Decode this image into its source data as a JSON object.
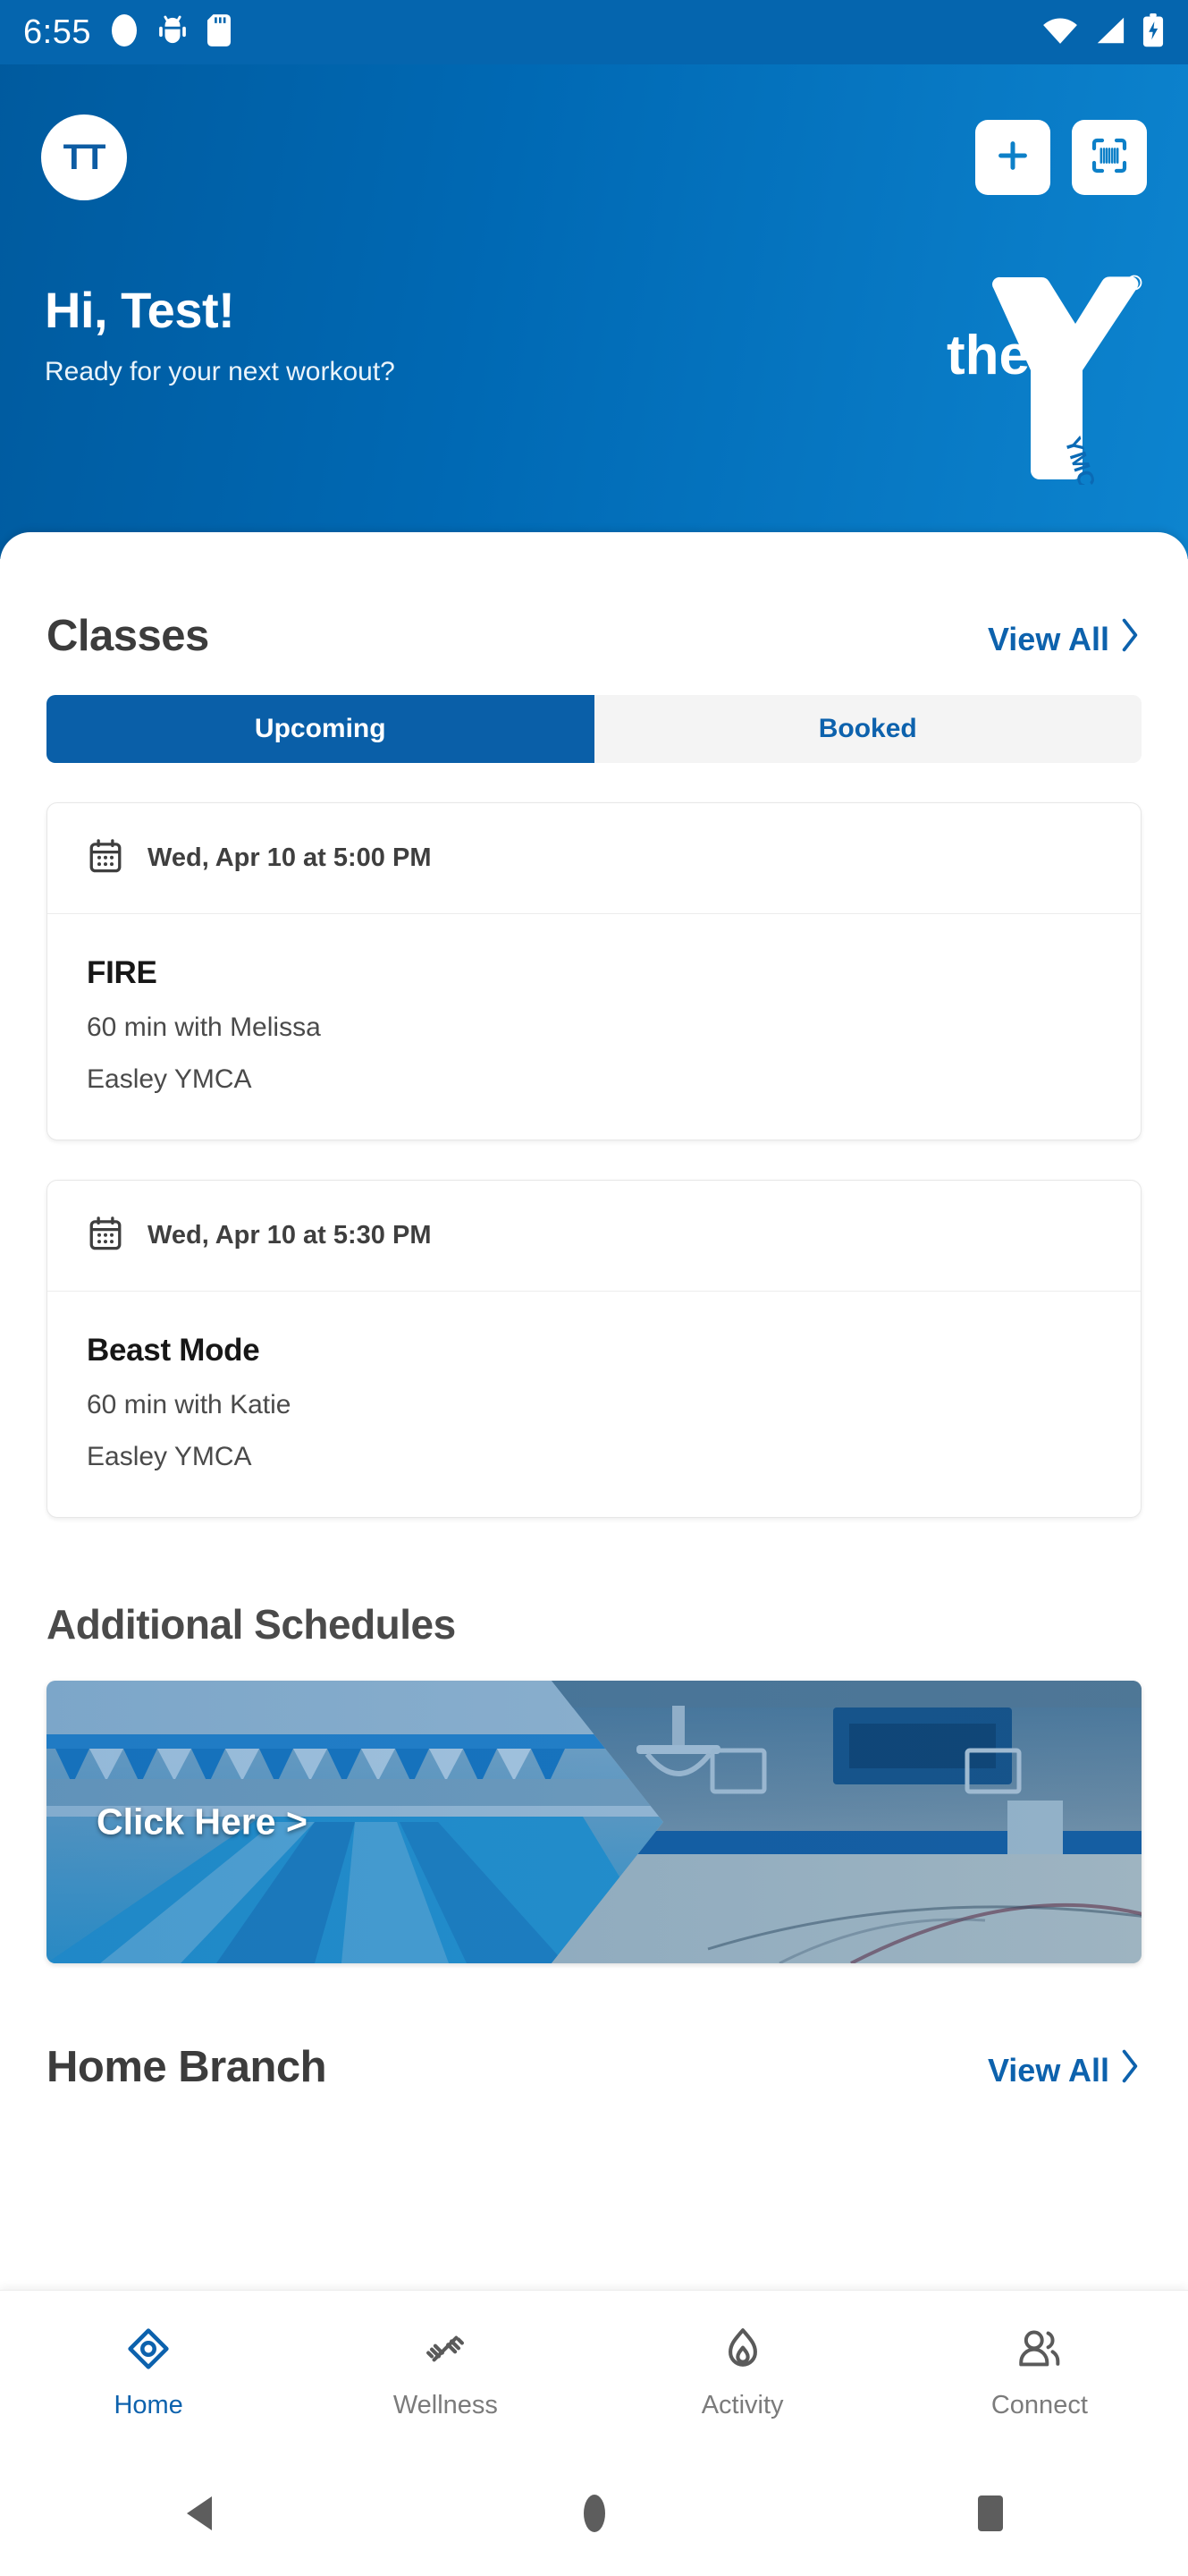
{
  "status_bar": {
    "time": "6:55",
    "left_icons": [
      "circle-icon",
      "android-bug-icon",
      "sd-card-icon"
    ],
    "right_icons": [
      "wifi-icon",
      "cellular-signal-icon",
      "battery-charging-icon"
    ],
    "background_color": "#0565ae"
  },
  "header": {
    "avatar_initials": "TT",
    "greeting": "Hi, Test!",
    "subtitle": "Ready for your next workout?",
    "add_button_label": "+",
    "scan_button_label": "scan-barcode",
    "logo": {
      "word": "the",
      "mark_label": "YMCA",
      "trademark": "®"
    },
    "gradient_from": "#005a9e",
    "gradient_to": "#0d84cf"
  },
  "classes": {
    "title": "Classes",
    "view_all_label": "View All",
    "tabs": [
      {
        "label": "Upcoming",
        "active": true
      },
      {
        "label": "Booked",
        "active": false
      }
    ],
    "items": [
      {
        "when": "Wed, Apr 10 at 5:00 PM",
        "name": "FIRE",
        "duration_instructor": "60 min with Melissa",
        "location": "Easley YMCA"
      },
      {
        "when": "Wed, Apr 10 at 5:30 PM",
        "name": "Beast Mode",
        "duration_instructor": "60 min with Katie",
        "location": "Easley YMCA"
      }
    ]
  },
  "additional_schedules": {
    "title": "Additional Schedules",
    "banner_label": "Click Here >"
  },
  "home_branch": {
    "title": "Home Branch",
    "view_all_label": "View All"
  },
  "bottom_nav": {
    "items": [
      {
        "label": "Home",
        "icon": "location-pin-icon",
        "active": true
      },
      {
        "label": "Wellness",
        "icon": "dumbbell-icon",
        "active": false
      },
      {
        "label": "Activity",
        "icon": "flame-icon",
        "active": false
      },
      {
        "label": "Connect",
        "icon": "people-icon",
        "active": false
      }
    ],
    "active_color": "#0d62ad",
    "idle_color": "#7b7b7b"
  },
  "system_nav": {
    "items": [
      "back-triangle-icon",
      "home-circle-icon",
      "recents-square-icon"
    ]
  },
  "theme": {
    "primary_blue": "#0a5fa8",
    "link_blue": "#0d62ad",
    "status_blue": "#0565ae"
  }
}
